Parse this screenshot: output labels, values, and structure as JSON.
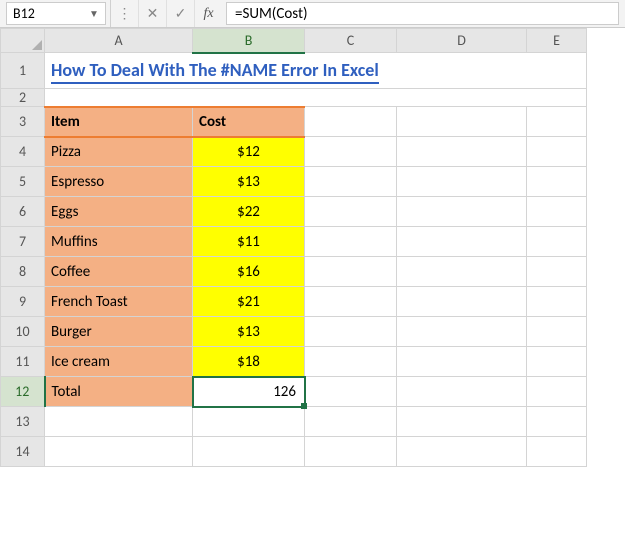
{
  "nameBox": {
    "value": "B12"
  },
  "formulaBar": {
    "cancel": "✕",
    "confirm": "✓",
    "fx": "fx",
    "formula": "=SUM(Cost)"
  },
  "columns": [
    "A",
    "B",
    "C",
    "D",
    "E"
  ],
  "rowNumbers": [
    "1",
    "2",
    "3",
    "4",
    "5",
    "6",
    "7",
    "8",
    "9",
    "10",
    "11",
    "12",
    "13",
    "14"
  ],
  "title": "How To Deal With The #NAME Error In Excel",
  "headers": {
    "item": "Item",
    "cost": "Cost"
  },
  "rows": [
    {
      "item": "Pizza",
      "cost": "$12"
    },
    {
      "item": "Espresso",
      "cost": "$13"
    },
    {
      "item": "Eggs",
      "cost": "$22"
    },
    {
      "item": "Muffins",
      "cost": "$11"
    },
    {
      "item": "Coffee",
      "cost": "$16"
    },
    {
      "item": "French Toast",
      "cost": "$21"
    },
    {
      "item": "Burger",
      "cost": "$13"
    },
    {
      "item": "Ice cream",
      "cost": "$18"
    }
  ],
  "total": {
    "label": "Total",
    "value": "126"
  },
  "activeCell": "B12",
  "chart_data": {
    "type": "table",
    "title": "How To Deal With The #NAME Error In Excel",
    "columns": [
      "Item",
      "Cost"
    ],
    "data": [
      [
        "Pizza",
        12
      ],
      [
        "Espresso",
        13
      ],
      [
        "Eggs",
        22
      ],
      [
        "Muffins",
        11
      ],
      [
        "Coffee",
        16
      ],
      [
        "French Toast",
        21
      ],
      [
        "Burger",
        13
      ],
      [
        "Ice cream",
        18
      ]
    ],
    "total": 126,
    "formula": "=SUM(Cost)"
  }
}
